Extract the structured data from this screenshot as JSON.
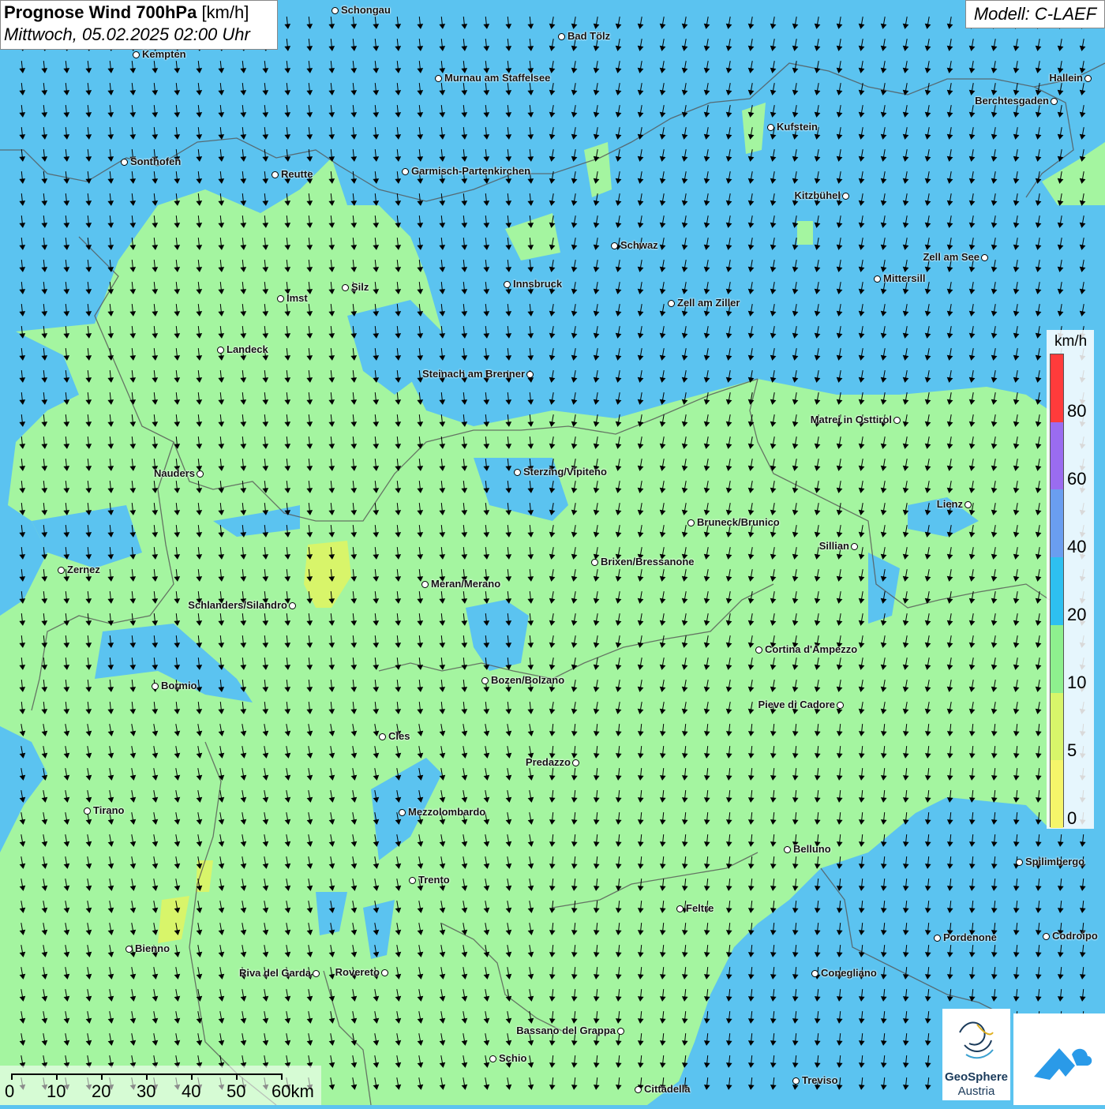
{
  "title": {
    "bold": "Prognose Wind 700hPa",
    "unit": "[km/h]",
    "datetime": "Mittwoch, 05.02.2025 02:00 Uhr"
  },
  "model": "Modell: C-LAEF",
  "legend": {
    "unit": "km/h",
    "labels": [
      "80",
      "60",
      "40",
      "20",
      "10",
      "5",
      "0"
    ],
    "colors": [
      "#ff3b3b",
      "#9a6cf0",
      "#6a9ef0",
      "#2ec0f0",
      "#8ef08e",
      "#d8f56a",
      "#f5f56a"
    ]
  },
  "scalebar": {
    "labels": [
      "0",
      "10",
      "20",
      "30",
      "40",
      "50",
      "60km"
    ]
  },
  "logo": {
    "line1": "GeoSphere",
    "line2": "Austria"
  },
  "cities": [
    {
      "name": "Schongau"
    },
    {
      "name": "Bad Tölz"
    },
    {
      "name": "Kempten"
    },
    {
      "name": "Murnau am Staffelsee"
    },
    {
      "name": "Hallein"
    },
    {
      "name": "Berchtesgaden"
    },
    {
      "name": "Kufstein"
    },
    {
      "name": "Sonthofen"
    },
    {
      "name": "Reutte"
    },
    {
      "name": "Garmisch-Partenkirchen"
    },
    {
      "name": "Kitzbühel"
    },
    {
      "name": "Schwaz"
    },
    {
      "name": "Zell am See"
    },
    {
      "name": "Mittersill"
    },
    {
      "name": "Imst"
    },
    {
      "name": "Silz"
    },
    {
      "name": "Innsbruck"
    },
    {
      "name": "Zell am Ziller"
    },
    {
      "name": "Landeck"
    },
    {
      "name": "Steinach am Brenner"
    },
    {
      "name": "Matrei in Osttirol"
    },
    {
      "name": "Nauders"
    },
    {
      "name": "Sterzing/Vipiteno"
    },
    {
      "name": "Lienz"
    },
    {
      "name": "Bruneck/Brunico"
    },
    {
      "name": "Sillian"
    },
    {
      "name": "Zernez"
    },
    {
      "name": "Brixen/Bressanone"
    },
    {
      "name": "Meran/Merano"
    },
    {
      "name": "Schlanders/Silandro"
    },
    {
      "name": "Cortina d'Ampezzo"
    },
    {
      "name": "Bozen/Bolzano"
    },
    {
      "name": "Bormio"
    },
    {
      "name": "Pieve di Cadore"
    },
    {
      "name": "Cles"
    },
    {
      "name": "Predazzo"
    },
    {
      "name": "Tirano"
    },
    {
      "name": "Mezzolombardo"
    },
    {
      "name": "Belluno"
    },
    {
      "name": "Spilimbergo"
    },
    {
      "name": "Trento"
    },
    {
      "name": "Feltre"
    },
    {
      "name": "Pordenone"
    },
    {
      "name": "Codroipo"
    },
    {
      "name": "Bienno"
    },
    {
      "name": "Riva del Garda"
    },
    {
      "name": "Rovereto"
    },
    {
      "name": "Conegliano"
    },
    {
      "name": "Bassano del Grappa"
    },
    {
      "name": "Schio"
    },
    {
      "name": "Treviso"
    },
    {
      "name": "Cittadella"
    }
  ]
}
